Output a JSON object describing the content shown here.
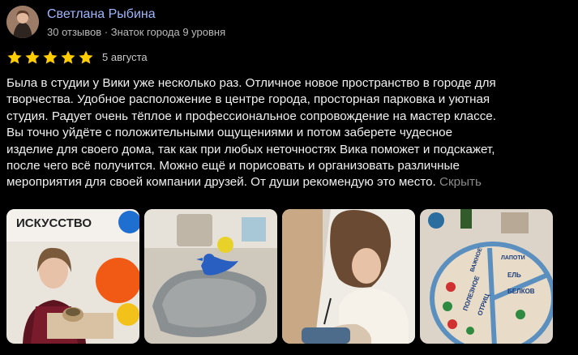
{
  "review": {
    "author": {
      "name": "Светлана Рыбина",
      "meta": "30 отзывов · Знаток города 9 уровня",
      "avatar_icon": "user-avatar"
    },
    "rating": 5,
    "rating_max": 5,
    "star_color": "#ffcc00",
    "date": "5 августа",
    "text_lines": [
      "Была в студии у Вики уже несколько раз. Отличное новое пространство в городе для",
      "творчества. Удобное расположение в центре города, просторная парковка и уютная",
      "студия. Радует очень тёплое и профессиональное сопровождение на мастер классе.",
      "Вы точно уйдёте с положительными ощущениями и потом заберете чудесное",
      "изделие для своего дома, так как при любых неточностях Вика поможет и подскажет,",
      "после чего всё получится. Можно ещё и порисовать и организовать различные",
      "мероприятия для своей компании друзей. От души рекомендую это место."
    ],
    "hide_label": "Скрыть",
    "photos": [
      {
        "sign_text": "ИСКУССТВО"
      },
      {},
      {},
      {
        "plate_texts": [
          "ВАЖНОЕ",
          "ПОЛЕЗНОЕ",
          "ОТРИЦ",
          "ЕЛЬ",
          "ЛАПОТИ",
          "БЕЛКОВ"
        ]
      }
    ]
  }
}
